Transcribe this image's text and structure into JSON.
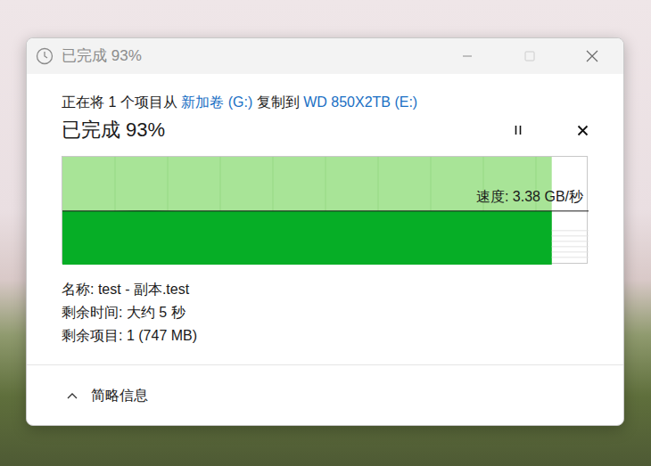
{
  "window": {
    "title": "已完成 93%",
    "maximize_disabled": true
  },
  "description": {
    "prefix": "正在将 1 个项目从",
    "source": "新加卷 (G:)",
    "middle": "复制到",
    "destination": "WD 850X2TB (E:)"
  },
  "heading": "已完成 93%",
  "progress": {
    "level": 0.93,
    "speed": "速度: 3.38 GB/秒",
    "current_speed": 3.38,
    "speed_history": [
      3.38,
      3.38,
      3.38,
      3.38,
      3.38,
      3.4,
      3.42,
      3.41,
      3.4,
      3.39,
      3.38,
      3.38,
      3.38,
      3.38,
      3.38,
      3.38,
      3.38,
      3.38,
      3.38,
      3.38,
      3.38,
      3.38,
      3.38,
      3.38,
      3.38,
      3.38,
      3.38,
      3.38,
      3.38,
      3.38,
      3.38,
      3.38,
      3.38,
      3.38,
      3.38,
      3.38,
      3.38,
      3.38,
      3.38,
      3.38
    ]
  },
  "details": [
    {
      "label": "名称:",
      "value": "test - 副本.test"
    },
    {
      "label": "剩余时间:",
      "value": "大约 5 秒"
    },
    {
      "label": "剩余项目:",
      "value": "1 (747 MB)"
    }
  ],
  "footer": {
    "label": "简略信息",
    "expanded": true
  }
}
